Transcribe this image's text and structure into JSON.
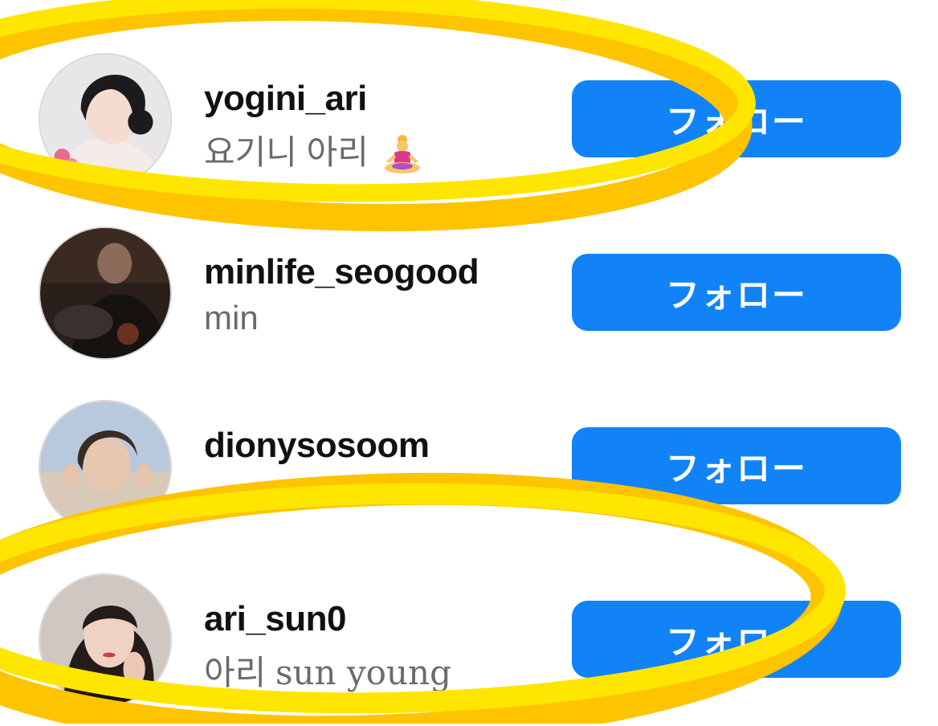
{
  "follow_list": [
    {
      "username": "yogini_ari",
      "display_name": "요기니 아리",
      "emoji": "person-in-lotus-position-emoji",
      "button_label": "フォロー"
    },
    {
      "username": "minlife_seogood",
      "display_name": "min",
      "button_label": "フォロー"
    },
    {
      "username": "dionysosoom",
      "display_name": "",
      "button_label": "フォロー"
    },
    {
      "username": "ari_sun0",
      "display_name_korean": "아리",
      "display_name_latin": "sun young",
      "button_label": "フォロー"
    }
  ],
  "colors": {
    "follow_button": "#1283f7",
    "highlight_circle": "#ffd800",
    "username_text": "#111111",
    "display_name_text": "#6b6b6b"
  }
}
